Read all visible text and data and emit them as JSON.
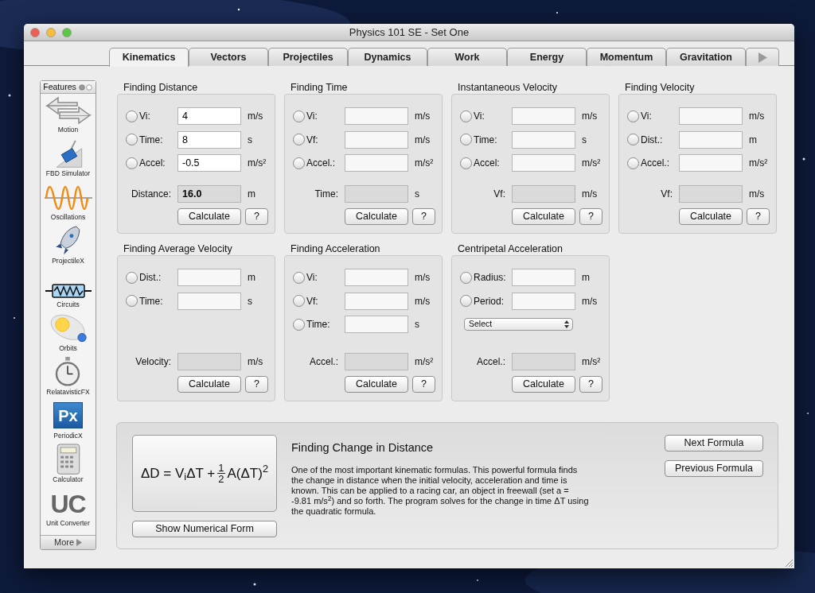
{
  "window": {
    "title": "Physics 101 SE - Set One"
  },
  "tabs": [
    {
      "label": "Kinematics",
      "selected": true
    },
    {
      "label": "Vectors",
      "selected": false
    },
    {
      "label": "Projectiles",
      "selected": false
    },
    {
      "label": "Dynamics",
      "selected": false
    },
    {
      "label": "Work",
      "selected": false
    },
    {
      "label": "Energy",
      "selected": false
    },
    {
      "label": "Momentum",
      "selected": false
    },
    {
      "label": "Gravitation",
      "selected": false
    }
  ],
  "sidebar": {
    "title": "Features",
    "items": [
      {
        "kind": "icon",
        "label": "Motion"
      },
      {
        "kind": "icon",
        "label": "FBD Simulator"
      },
      {
        "kind": "icon",
        "label": "Oscillations"
      },
      {
        "kind": "icon",
        "label": "ProjectileX"
      },
      {
        "kind": "icon",
        "label": "Circuits"
      },
      {
        "kind": "icon",
        "label": "Orbits"
      },
      {
        "kind": "icon",
        "label": "RelatavisticFX"
      },
      {
        "kind": "tile",
        "letters": "Px",
        "label": "PeriodicX"
      },
      {
        "kind": "icon",
        "label": "Calculator"
      },
      {
        "kind": "letters",
        "letters": "UC",
        "label": "Unit Converter"
      }
    ],
    "more": "More"
  },
  "calculators": [
    {
      "title": "Finding Distance",
      "rows": [
        {
          "kind": "input",
          "label": "Vi:",
          "value": "4",
          "unit": "m/s",
          "selected": false
        },
        {
          "kind": "input",
          "label": "Time:",
          "value": "8",
          "unit": "s",
          "selected": false
        },
        {
          "kind": "input",
          "label": "Accel:",
          "value": "-0.5",
          "unit": "m/s²",
          "selected": false
        },
        {
          "kind": "result",
          "label": "Distance:",
          "value": "16.0",
          "unit": "m"
        }
      ],
      "button": "Calculate",
      "help": "?"
    },
    {
      "title": "Finding Time",
      "rows": [
        {
          "kind": "input",
          "label": "Vi:",
          "unit": "m/s",
          "selected": false
        },
        {
          "kind": "input",
          "label": "Vf:",
          "unit": "m/s",
          "selected": false
        },
        {
          "kind": "input",
          "label": "Accel.:",
          "unit": "m/s²",
          "selected": false
        },
        {
          "kind": "result",
          "label": "Time:",
          "unit": "s"
        }
      ],
      "button": "Calculate",
      "help": "?"
    },
    {
      "title": "Instantaneous Velocity",
      "rows": [
        {
          "kind": "input",
          "label": "Vi:",
          "unit": "m/s",
          "selected": false
        },
        {
          "kind": "input",
          "label": "Time:",
          "unit": "s",
          "selected": false
        },
        {
          "kind": "input",
          "label": "Accel:",
          "unit": "m/s²",
          "selected": false
        },
        {
          "kind": "result",
          "label": "Vf:",
          "unit": "m/s"
        }
      ],
      "button": "Calculate",
      "help": "?"
    },
    {
      "title": "Finding Velocity",
      "rows": [
        {
          "kind": "input",
          "label": "Vi:",
          "unit": "m/s",
          "selected": false
        },
        {
          "kind": "input",
          "label": "Dist.:",
          "unit": "m",
          "selected": false
        },
        {
          "kind": "input",
          "label": "Accel.:",
          "unit": "m/s²",
          "selected": false
        },
        {
          "kind": "result",
          "label": "Vf:",
          "unit": "m/s"
        }
      ],
      "button": "Calculate",
      "help": "?"
    },
    {
      "title": "Finding Average Velocity",
      "rows": [
        {
          "kind": "input",
          "label": "Dist.:",
          "unit": "m",
          "selected": false
        },
        {
          "kind": "input",
          "label": "Time:",
          "unit": "s",
          "selected": false
        },
        {
          "kind": "result",
          "label": "Velocity:",
          "unit": "m/s"
        }
      ],
      "button": "Calculate",
      "help": "?"
    },
    {
      "title": "Finding Acceleration",
      "rows": [
        {
          "kind": "input",
          "label": "Vi:",
          "unit": "m/s",
          "selected": false
        },
        {
          "kind": "input",
          "label": "Vf:",
          "unit": "m/s",
          "selected": false
        },
        {
          "kind": "input",
          "label": "Time:",
          "unit": "s",
          "selected": false
        },
        {
          "kind": "result",
          "label": "Accel.:",
          "unit": "m/s²"
        }
      ],
      "button": "Calculate",
      "help": "?"
    },
    {
      "title": "Centripetal Acceleration",
      "rows": [
        {
          "kind": "input",
          "label": "Radius:",
          "unit": "m",
          "selected": false
        },
        {
          "kind": "input",
          "label": "Period:",
          "unit": "m/s",
          "selected": false
        },
        {
          "kind": "select",
          "value": "Select"
        },
        {
          "kind": "result",
          "label": "Accel.:",
          "unit": "m/s²"
        }
      ],
      "button": "Calculate",
      "help": "?"
    }
  ],
  "formula_panel": {
    "formula": {
      "lhs": "ΔD = V$_{i}$ΔT +",
      "numerator": "1",
      "denominator": "2",
      "rhs": "A(ΔT)$^{2}$"
    },
    "show_button": "Show Numerical Form",
    "title": "Finding Change in Distance",
    "description": "One of the most important kinematic formulas. This powerful formula finds the change in distance when the initial velocity, acceleration and time is known. This can be applied to a racing car, an object in freewall (set a = -9.81 m/s$^{2}$) and so forth. The program solves for the change in time ΔT using the quadratic formula.",
    "buttons": [
      "Next Formula",
      "Previous Formula"
    ]
  }
}
